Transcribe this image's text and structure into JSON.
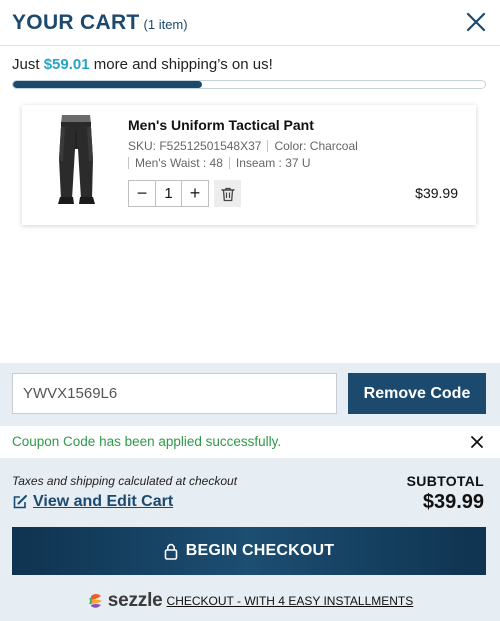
{
  "header": {
    "title": "YOUR CART",
    "count": "(1 item)"
  },
  "shipping": {
    "prefix": "Just",
    "amount": "$59.01",
    "suffix": "more and shipping’s on us!",
    "progress_percent": 40
  },
  "item": {
    "name": "Men's Uniform Tactical Pant",
    "sku": "SKU: F52512501548X37",
    "color": "Color:  Charcoal",
    "waist": "Men's Waist :  48",
    "inseam": "Inseam :  37 U",
    "quantity": "1",
    "minus": "−",
    "plus": "+",
    "price": "$39.99"
  },
  "coupon": {
    "code": "YWVX1569L6",
    "remove_label": "Remove Code",
    "success_message": "Coupon Code has been applied successfully."
  },
  "summary": {
    "tax_note": "Taxes and shipping calculated at checkout",
    "edit_cart": "View and Edit Cart",
    "subtotal_label": "SUBTOTAL",
    "subtotal_value": "$39.99"
  },
  "checkout": {
    "label": "BEGIN CHECKOUT"
  },
  "sezzle": {
    "brand": "sezzle",
    "tagline": "CHECKOUT - WITH 4 EASY INSTALLMENTS"
  },
  "colors": {
    "brand_navy": "#1c4a6e",
    "accent_teal": "#2aa3c8",
    "success_green": "#2e9a49",
    "footer_bg": "#e6edf3"
  }
}
